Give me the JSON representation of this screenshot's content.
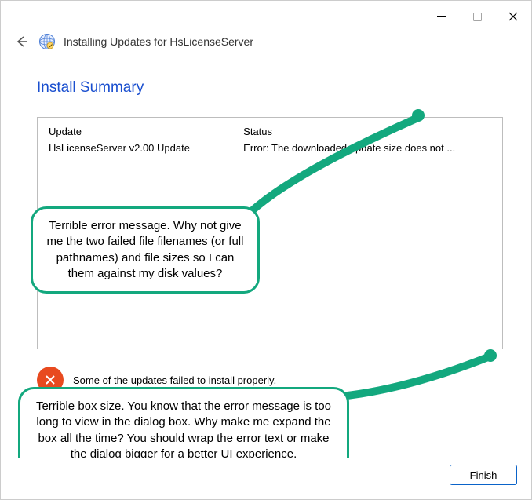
{
  "titlebar": {
    "minimize_icon": "minimize",
    "maximize_icon": "maximize",
    "close_icon": "close"
  },
  "header": {
    "back_icon": "back",
    "app_icon": "globe",
    "title": "Installing Updates for HsLicenseServer"
  },
  "summary": {
    "heading": "Install Summary",
    "columns": {
      "update": "Update",
      "status": "Status"
    },
    "rows": [
      {
        "update": "HsLicenseServer v2.00 Update",
        "status": "Error: The downloaded update size does not ..."
      }
    ]
  },
  "status": {
    "icon": "error",
    "text": "Some of the updates failed to install properly."
  },
  "footer": {
    "finish_label": "Finish"
  },
  "callouts": {
    "c1": "Terrible error message. Why not give me the two failed file filenames (or full pathnames) and file sizes so I can them against my disk values?",
    "c2": "Terrible box size. You know that the error message is too long to view in the dialog box. Why make me expand the box all the time? You should wrap the error text or make the dialog bigger for a better UI experience."
  },
  "colors": {
    "accent": "#1a4fcf",
    "callout_border": "#13a87e",
    "error": "#e84a1f"
  }
}
